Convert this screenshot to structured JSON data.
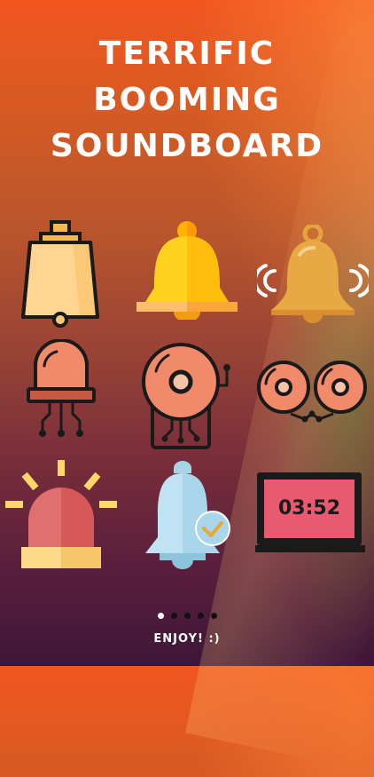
{
  "title": {
    "line1": "TERRIFIC",
    "line2": "BOOMING",
    "line3": "SOUNDBOARD"
  },
  "icons": [
    {
      "name": "cowbell-icon"
    },
    {
      "name": "bell-icon"
    },
    {
      "name": "ringing-bell-icon"
    },
    {
      "name": "beacon-light-icon"
    },
    {
      "name": "school-bell-icon"
    },
    {
      "name": "double-alarm-bell-icon"
    },
    {
      "name": "siren-icon"
    },
    {
      "name": "notification-bell-icon"
    },
    {
      "name": "digital-clock-icon"
    }
  ],
  "clock_display": "03:52",
  "pagination": {
    "count": 5,
    "active": 1
  },
  "footer": {
    "enjoy": "ENJOY! :)"
  },
  "colors": {
    "background_top": "#f2561f",
    "background_bottom": "#3e1638",
    "title_text": "#ffffff",
    "bell_yellow": "#ffcf1f",
    "coral": "#f08070",
    "clock_screen": "#e85a70"
  }
}
